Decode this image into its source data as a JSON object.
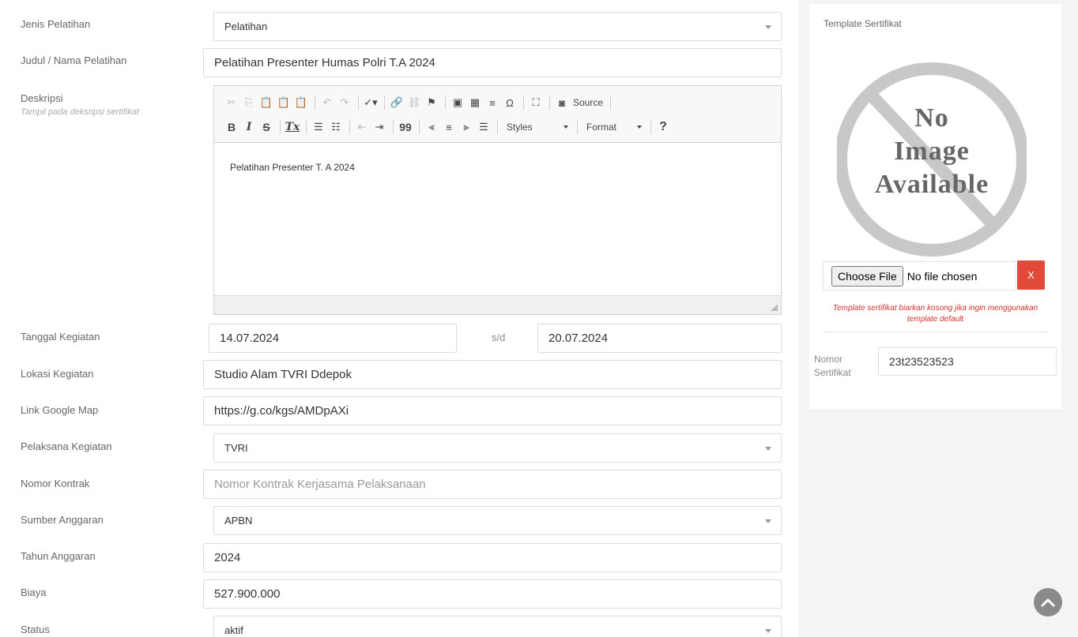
{
  "form": {
    "jenis": {
      "label": "Jenis Pelatihan",
      "value": "Pelatihan"
    },
    "judul": {
      "label": "Judul / Nama Pelatihan",
      "value": "Pelatihan Presenter Humas Polri T.A 2024"
    },
    "deskripsi": {
      "label": "Deskripsi",
      "hint": "Tampil pada deksripsi sertifikat",
      "content": "Pelatihan Presenter  T. A 2024",
      "toolbar": {
        "source_label": "Source",
        "styles_label": "Styles",
        "format_label": "Format",
        "bold": "B",
        "italic": "I",
        "strike": "S",
        "remove_format": "Tx",
        "blockquote": "99",
        "help": "?"
      }
    },
    "tanggal": {
      "label": "Tanggal Kegiatan",
      "start": "14.07.2024",
      "separator": "s/d",
      "end": "20.07.2024"
    },
    "lokasi": {
      "label": "Lokasi Kegiatan",
      "value": "Studio Alam TVRI Ddepok"
    },
    "link_map": {
      "label": "Link Google Map",
      "value": "https://g.co/kgs/AMDpAXi"
    },
    "pelaksana": {
      "label": "Pelaksana Kegiatan",
      "value": "TVRI"
    },
    "nomor_kontrak": {
      "label": "Nomor Kontrak",
      "placeholder": "Nomor Kontrak Kerjasama Pelaksanaan"
    },
    "sumber": {
      "label": "Sumber Anggaran",
      "value": "APBN"
    },
    "tahun": {
      "label": "Tahun Anggaran",
      "value": "2024"
    },
    "biaya": {
      "label": "Biaya",
      "value": "527.900.000"
    },
    "status": {
      "label": "Status",
      "value": "aktif"
    }
  },
  "certificate": {
    "title": "Template Sertifikat",
    "no_image_lines": [
      "No",
      "Image",
      "Available"
    ],
    "choose_file_label": "Choose File",
    "file_status": "No file chosen",
    "clear_label": "X",
    "help": "Template sertifikat biarkan kosong jika ingin menggunakan template default",
    "nomor_label_line1": "Nomor",
    "nomor_label_line2": "Sertifikat",
    "nomor_value": "23t23523523"
  },
  "colors": {
    "clear_button": "#e14a3a",
    "help_text": "#d0312d",
    "scroll_top": "#8a8a8a"
  }
}
